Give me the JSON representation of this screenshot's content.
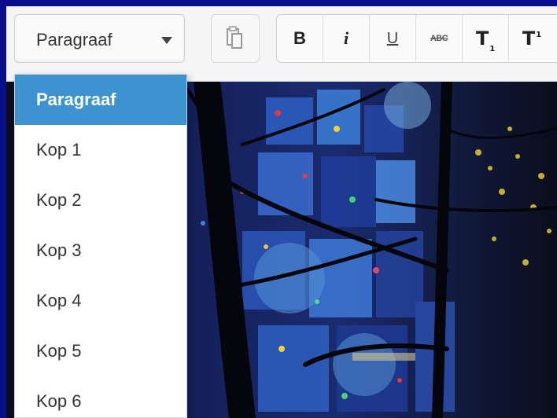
{
  "toolbar": {
    "format_select": {
      "label": "Paragraaf"
    },
    "buttons": {
      "bold": "B",
      "italic": "i",
      "underline": "U",
      "strikethrough": "ABC",
      "subscript": "T",
      "subscript_mark": "1",
      "superscript": "T",
      "superscript_mark": "1"
    }
  },
  "dropdown": {
    "items": [
      "Paragraaf",
      "Kop 1",
      "Kop 2",
      "Kop 3",
      "Kop 4",
      "Kop 5",
      "Kop 6"
    ],
    "selected": "Paragraaf"
  },
  "colors": {
    "border_frame": "#0a0f8c",
    "selected_item": "#3d93cf",
    "toolbar_bg": "#f5f5f5"
  }
}
